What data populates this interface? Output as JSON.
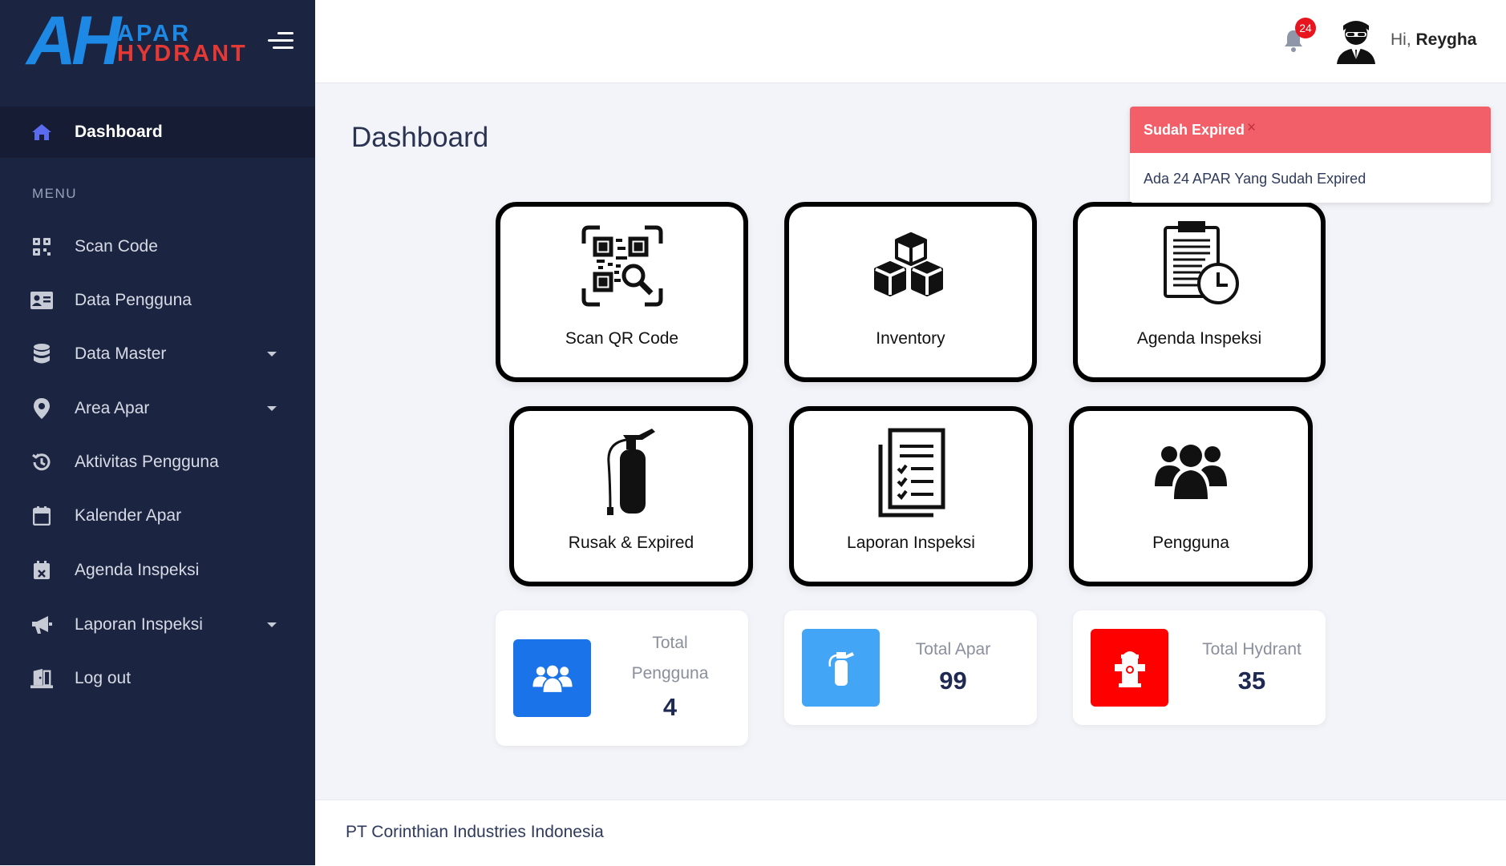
{
  "brand": {
    "initials": "AH",
    "line1": "APAR",
    "line2": "HYDRANT"
  },
  "sidebar": {
    "active": {
      "label": "Dashboard",
      "icon": "home-icon"
    },
    "menu_heading": "MENU",
    "items": [
      {
        "label": "Scan Code",
        "icon": "qr-code-icon"
      },
      {
        "label": "Data Pengguna",
        "icon": "id-card-icon"
      },
      {
        "label": "Data Master",
        "icon": "database-icon"
      },
      {
        "label": "Area Apar",
        "icon": "map-pin-icon"
      },
      {
        "label": "Aktivitas Pengguna",
        "icon": "history-icon"
      },
      {
        "label": "Kalender Apar",
        "icon": "calendar-icon"
      },
      {
        "label": "Agenda Inspeksi",
        "icon": "calendar-x-icon"
      },
      {
        "label": "Laporan Inspeksi",
        "icon": "megaphone-icon"
      },
      {
        "label": "Log out",
        "icon": "door-exit-icon"
      }
    ]
  },
  "topbar": {
    "notification_count": "24",
    "greeting_prefix": "Hi,",
    "user_name": "Reygha"
  },
  "main": {
    "title": "Dashboard",
    "cards": [
      {
        "label": "Scan QR Code",
        "icon": "qr-scan-icon"
      },
      {
        "label": "Inventory",
        "icon": "boxes-icon"
      },
      {
        "label": "Agenda Inspeksi",
        "icon": "clipboard-clock-icon"
      },
      {
        "label": "Rusak & Expired",
        "icon": "fire-extinguisher-icon"
      },
      {
        "label": "Laporan Inspeksi",
        "icon": "report-checklist-icon"
      },
      {
        "label": "Pengguna",
        "icon": "users-icon"
      }
    ],
    "stats": [
      {
        "title_line1": "Total",
        "title_line2": "Pengguna",
        "value": "4",
        "color": "#1a73e8"
      },
      {
        "title": "Total Apar",
        "value": "99",
        "color": "#42a5f5"
      },
      {
        "title": "Total Hydrant",
        "value": "35",
        "color": "#ff0000"
      }
    ]
  },
  "toast": {
    "title": "Sudah Expired",
    "close": "×",
    "message": "Ada 24 APAR Yang Sudah Expired"
  },
  "footer": {
    "company": "PT Corinthian Industries Indonesia"
  }
}
